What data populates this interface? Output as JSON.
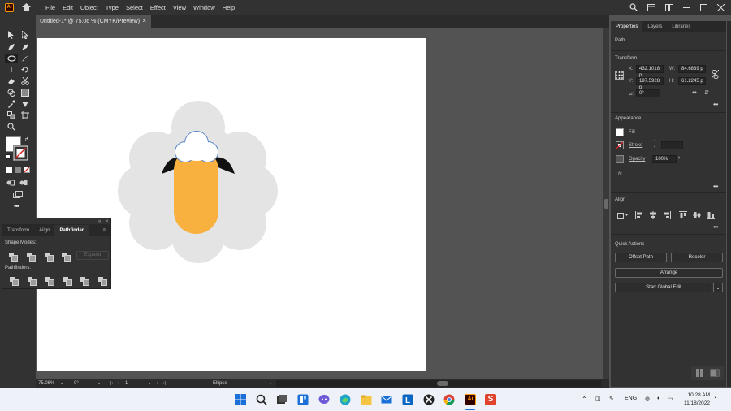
{
  "app": {
    "logo_text": "Ai"
  },
  "menu": [
    "File",
    "Edit",
    "Object",
    "Type",
    "Select",
    "Effect",
    "View",
    "Window",
    "Help"
  ],
  "document_tab": {
    "title": "Untitled-1* @ 75.06 % (CMYK/Preview)",
    "close": "×"
  },
  "pathfinder_panel": {
    "tabs": [
      "Transform",
      "Align",
      "Pathfinder"
    ],
    "active_tab": "Pathfinder",
    "shape_modes_label": "Shape Modes:",
    "expand_label": "Expand",
    "pathfinders_label": "Pathfinders:"
  },
  "properties_panel": {
    "tabs": [
      "Properties",
      "Layers",
      "Libraries"
    ],
    "selection_type": "Path",
    "transform": {
      "title": "Transform",
      "x_label": "X:",
      "x_value": "432.1018 p",
      "y_label": "Y:",
      "y_value": "197.5928 p",
      "w_label": "W:",
      "w_value": "84.6839 p",
      "h_label": "H:",
      "h_value": "61.2245 p",
      "rotate_label": "⊿:",
      "rotate_value": "0°"
    },
    "appearance": {
      "title": "Appearance",
      "fill_label": "Fill",
      "stroke_label": "Stroke",
      "opacity_label": "Opacity",
      "opacity_value": "100%",
      "fx_label": "fx."
    },
    "align_title": "Align",
    "quick_actions": {
      "title": "Quick Actions",
      "offset_path": "Offset Path",
      "recolor": "Recolor",
      "arrange": "Arrange",
      "global_edit": "Start Global Edit"
    }
  },
  "status_bar": {
    "zoom": "75.06%",
    "rotation": "0°",
    "artboard": "1",
    "tool": "Ellipse"
  },
  "taskbar": {
    "language": "ENG",
    "time": "10:28 AM",
    "date": "11/18/2022"
  },
  "colors": {
    "cloud": "#e4e4e4",
    "face": "#f8b03f",
    "ears": "#111111",
    "topknot_stroke": "#5b85c8"
  }
}
